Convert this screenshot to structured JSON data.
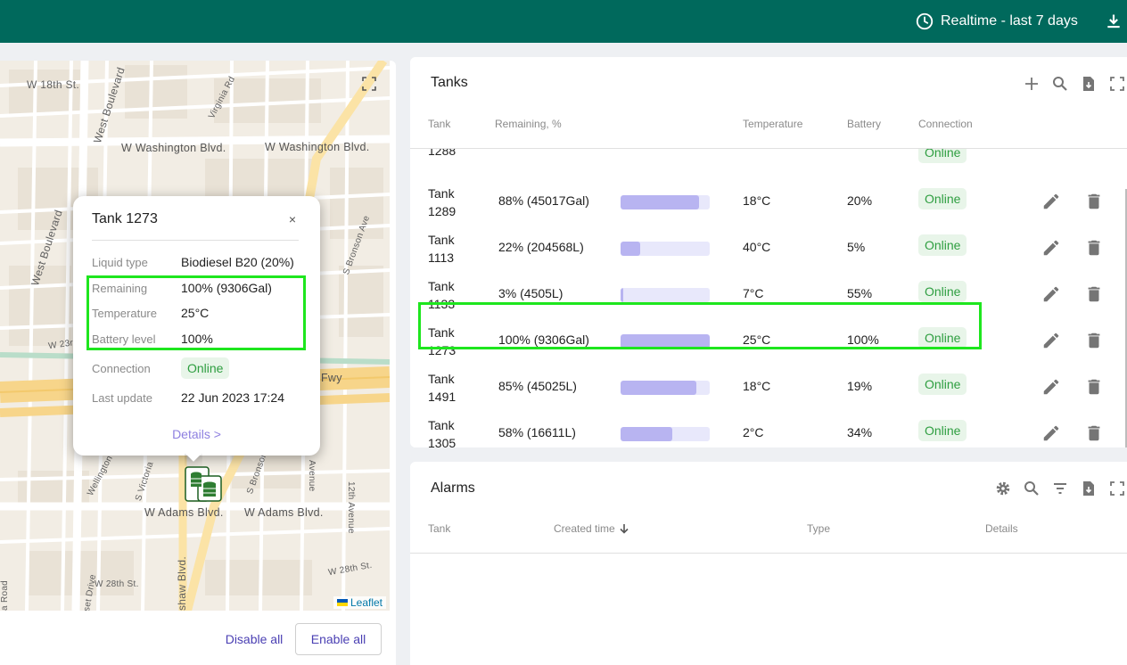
{
  "header": {
    "time_window": "Realtime - last 7 days",
    "clock_icon": "clock-icon",
    "download_icon": "download-icon"
  },
  "map": {
    "streets": [
      "W 18th St.",
      "West Boulevard",
      "Virginia Rd",
      "W Washington Blvd.",
      "W Washington Blvd.",
      "West Boulevard",
      "S Bronson Ave",
      "W 23rd St",
      "Fwy",
      "Wellington",
      "S Victoria",
      "S Bronson Ave",
      "12th Avenue",
      "Avenue",
      "W Adams Blvd.",
      "W Adams Blvd.",
      "W 28th St.",
      "W 28th St.",
      "shaw Blvd.",
      "set Drive",
      "a Road"
    ],
    "attribution": "Leaflet",
    "marker_icon": "tank-marker-icon",
    "popup": {
      "title": "Tank 1273",
      "close": "×",
      "rows": [
        {
          "key": "Liquid type",
          "value": "Biodiesel B20 (20%)"
        },
        {
          "key": "Remaining",
          "value": "100% (9306Gal)"
        },
        {
          "key": "Temperature",
          "value": "25°C"
        },
        {
          "key": "Battery level",
          "value": "100%"
        },
        {
          "key": "Connection",
          "value": "Online"
        },
        {
          "key": "Last update",
          "value": "22 Jun 2023 17:24"
        }
      ],
      "details": "Details >"
    },
    "disable_all": "Disable all",
    "enable_all": "Enable all"
  },
  "tanks": {
    "title": "Tanks",
    "columns": [
      "Tank",
      "Remaining, %",
      "Temperature",
      "Battery",
      "Connection"
    ],
    "partial_row": {
      "tank": "1288",
      "connection": "Online"
    },
    "rows": [
      {
        "tank": "Tank 1289",
        "remaining": "88% (45017Gal)",
        "fill": 0.88,
        "temperature": "18°C",
        "battery": "20%",
        "connection": "Online"
      },
      {
        "tank": "Tank 1113",
        "remaining": "22% (204568L)",
        "fill": 0.22,
        "temperature": "40°C",
        "battery": "5%",
        "connection": "Online"
      },
      {
        "tank": "Tank 1133",
        "remaining": "3% (4505L)",
        "fill": 0.03,
        "temperature": "7°C",
        "battery": "55%",
        "connection": "Online"
      },
      {
        "tank": "Tank 1273",
        "remaining": "100% (9306Gal)",
        "fill": 1.0,
        "temperature": "25°C",
        "battery": "100%",
        "connection": "Online"
      },
      {
        "tank": "Tank 1491",
        "remaining": "85% (45025L)",
        "fill": 0.85,
        "temperature": "18°C",
        "battery": "19%",
        "connection": "Online"
      },
      {
        "tank": "Tank 1305",
        "remaining": "58% (16611L)",
        "fill": 0.58,
        "temperature": "2°C",
        "battery": "34%",
        "connection": "Online"
      }
    ]
  },
  "alarms": {
    "title": "Alarms",
    "columns": [
      "Tank",
      "Created time",
      "Type",
      "Details"
    ]
  },
  "colors": {
    "header": "#00695c",
    "accent": "#4a3fb3",
    "online_text": "#2e9e40",
    "online_bg": "#e8f5e9",
    "bar_fill": "#b8b4f1",
    "bar_track": "#e8e8fb",
    "highlight": "#1ee61e"
  }
}
